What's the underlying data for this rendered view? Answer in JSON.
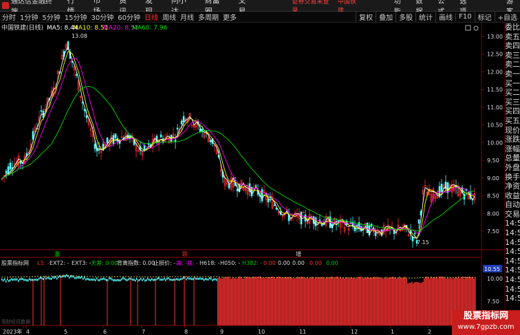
{
  "topbar": {
    "app_title": "通达信金融终端",
    "menu": [
      "行情",
      "市场",
      "资讯",
      "发现",
      "问小达",
      "财富圈",
      "交易"
    ],
    "warning": "证券交易未登录",
    "stock_name": "中国铁建",
    "right_menu": [
      "功能",
      "数据",
      "公式",
      "选项"
    ],
    "guest": "游客"
  },
  "periods": [
    "分时",
    "1分钟",
    "5分钟",
    "15分钟",
    "30分钟",
    "60分钟",
    "日线",
    "周线",
    "月线",
    "多周期",
    "更多"
  ],
  "selected_period": "日线",
  "toolbar_right": [
    "复权",
    "叠加",
    "多股",
    "统计",
    "画线",
    "F10",
    "标记",
    "+自选"
  ],
  "main_legend": {
    "title": "中国铁建(日线)",
    "ma5": "MA5: 8.44",
    "ma10": "MA10: 8.51",
    "ma20": "MA20: 8.52",
    "ma60": "MA60: 7.96"
  },
  "price_ticks": [
    "13.00",
    "12.50",
    "12.00",
    "11.50",
    "11.00",
    "10.50",
    "10.00",
    "9.50",
    "9.00",
    "8.50",
    "8.00",
    "7.50"
  ],
  "high_label": "13.08",
  "low_label": "7.15",
  "last_price": "10.55",
  "markers": {
    "m1": "涨",
    "m2": "跌",
    "m3": "增"
  },
  "sub_legend": {
    "title": "股票指标网",
    "l1": "L1: -",
    "ext2": "EXT2: -",
    "ext3": "EXT3: -",
    "tianchai": "天差: 0.00",
    "beili": "背离指数: 0.00",
    "zhisun": "止损价: -",
    "gao": "高: -",
    "di": "底: -",
    "h618": "H618: -",
    "h050": "H050: -",
    "h382": "H382: -",
    "v1": "0.00",
    "v2": "0.00",
    "v3": "0.00",
    "v4": "0.00",
    "v5": "0.00"
  },
  "sub_ticks": [
    "10.00",
    "7.50"
  ],
  "xaxis": [
    "2023年",
    "4",
    "5",
    "6",
    "7",
    "8",
    "9",
    "10",
    "11",
    "12",
    "1",
    "2"
  ],
  "right_panel": [
    "委比",
    "卖五",
    "卖四",
    "卖三",
    "卖二",
    "卖一",
    "买一",
    "买二",
    "买三",
    "买四",
    "买五",
    "现价",
    "涨跌",
    "涨幅",
    "总量",
    "外盘",
    "换手",
    "净资",
    "收益",
    "自动",
    "交易",
    "14:50",
    "14:50",
    "14:50",
    "14:50",
    "14:50",
    "14:50",
    "14:50",
    "14:50",
    "14:5"
  ],
  "watermark": {
    "line1": "股票指标网",
    "line2": "www.7gpzb.com"
  },
  "bottom_left": "用财经讯数据",
  "colors": {
    "up": "#ff3232",
    "down": "#54ffff",
    "ma5": "#ffffff",
    "ma10": "#ffff00",
    "ma20": "#ff00ff",
    "ma60": "#00e000",
    "bg": "#000000"
  }
}
